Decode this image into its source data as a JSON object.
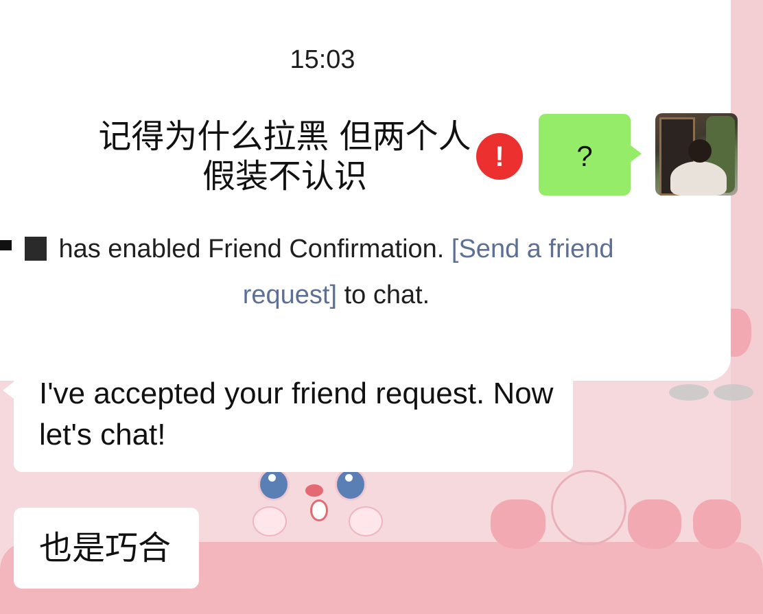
{
  "chat": {
    "timestamp": "15:03",
    "sent_message": "记得为什么拉黑 但两个人假装不认识",
    "sent_bubble": "?",
    "error_icon": "!",
    "system_notice_before": "has enabled Friend Confirmation. ",
    "system_notice_link": "[Send a friend request]",
    "system_notice_after": " to chat.",
    "received_messages": [
      "I've accepted your friend request. Now let's chat!",
      "也是巧合"
    ]
  },
  "colors": {
    "sent_bubble": "#95ec69",
    "error_badge": "#ec2f2f",
    "link": "#5c6f94",
    "chat_background": "#f6d9dc"
  },
  "icons": {
    "error": "exclamation-circle-icon",
    "avatar": "user-avatar-photo"
  }
}
